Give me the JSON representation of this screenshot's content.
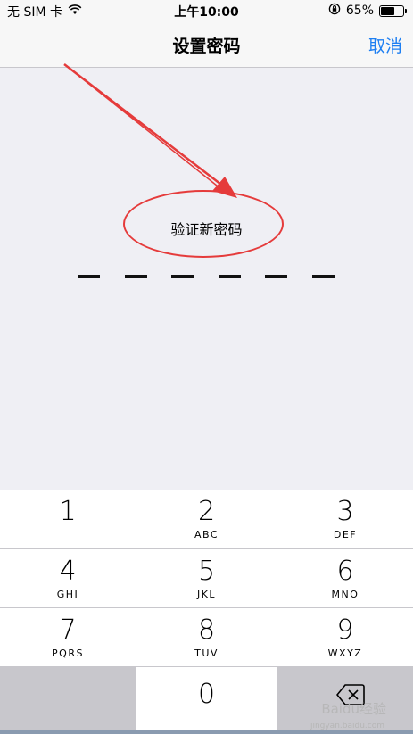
{
  "status_bar": {
    "carrier": "无 SIM 卡",
    "wifi_icon": "wifi-icon",
    "time": "上午10:00",
    "lock_icon": "orientation-lock-icon",
    "battery_percent": "65%",
    "battery_level": 0.65
  },
  "nav": {
    "title": "设置密码",
    "cancel_label": "取消"
  },
  "prompt": "验证新密码",
  "passcode": {
    "length": 6,
    "entered": 0
  },
  "keypad": {
    "keys": [
      {
        "digit": "1",
        "letters": ""
      },
      {
        "digit": "2",
        "letters": "ABC"
      },
      {
        "digit": "3",
        "letters": "DEF"
      },
      {
        "digit": "4",
        "letters": "GHI"
      },
      {
        "digit": "5",
        "letters": "JKL"
      },
      {
        "digit": "6",
        "letters": "MNO"
      },
      {
        "digit": "7",
        "letters": "PQRS"
      },
      {
        "digit": "8",
        "letters": "TUV"
      },
      {
        "digit": "9",
        "letters": "WXYZ"
      }
    ],
    "zero": "0",
    "delete_icon": "backspace-icon"
  },
  "watermark": {
    "brand": "Baidu经验",
    "url": "jingyan.baidu.com"
  },
  "colors": {
    "accent": "#1e7ff2",
    "annotation": "#e53b3b",
    "background": "#efeff4"
  }
}
